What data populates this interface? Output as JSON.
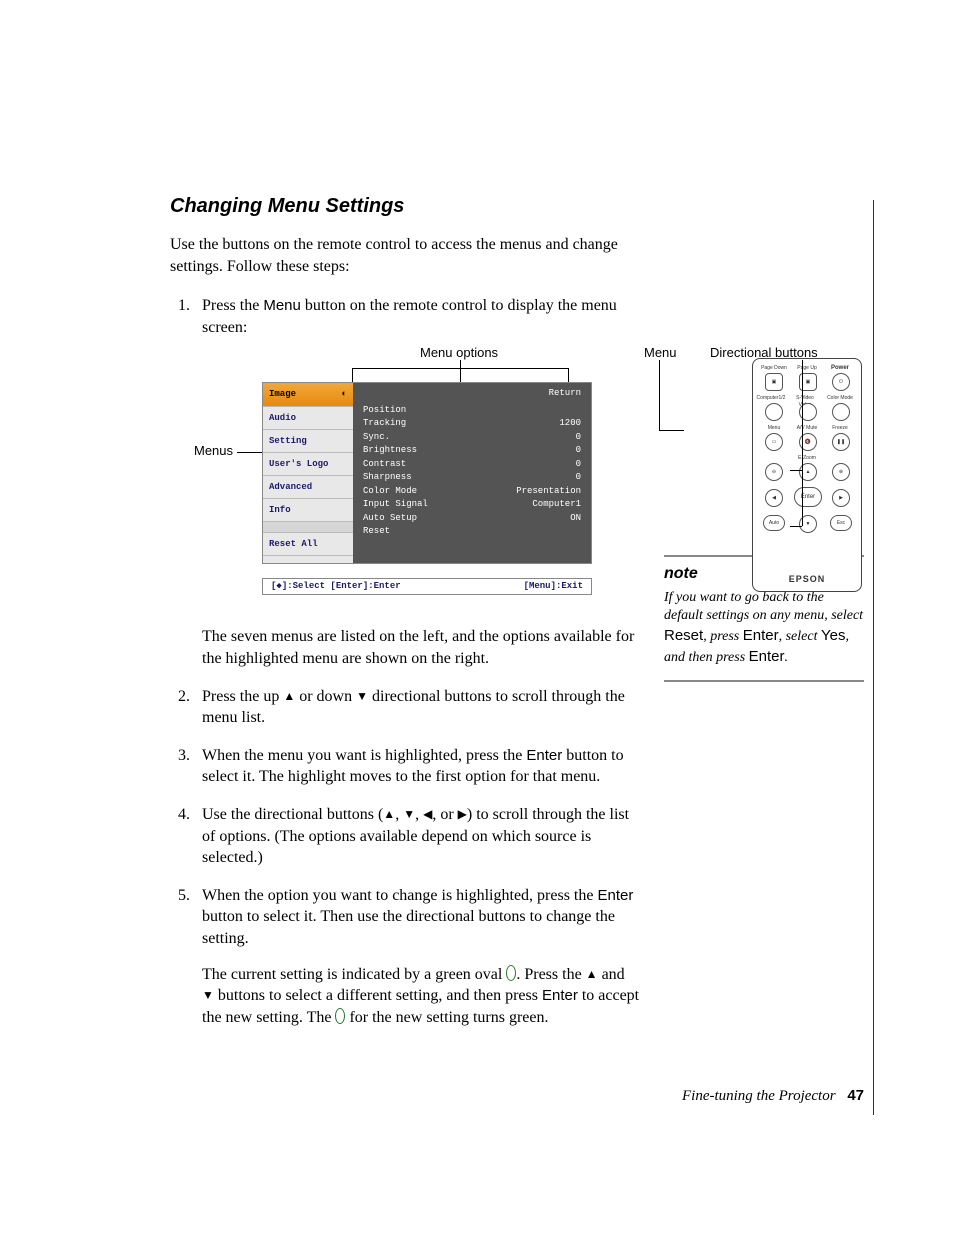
{
  "heading": "Changing Menu Settings",
  "intro": "Use the buttons on the remote control to access the menus and change settings. Follow these steps:",
  "steps": {
    "s1_a": "Press the ",
    "s1_menu": "Menu",
    "s1_b": " button on the remote control to display the menu screen:",
    "s1_after_a": "The seven menus are listed on the left, and the options available for the highlighted menu are shown on the right.",
    "s2_a": "Press the up ",
    "s2_b": " or down ",
    "s2_c": " directional buttons to scroll through the menu list.",
    "s3_a": "When the menu you want is highlighted, press the ",
    "s3_enter": "Enter",
    "s3_b": " button to select it. The highlight moves to the first option for that menu.",
    "s4_a": "Use the directional buttons (",
    "s4_b": ", ",
    "s4_c": ", ",
    "s4_d": ", or ",
    "s4_e": ") to scroll through the list of options. (The options available depend on which source is selected.)",
    "s5_a": "When the option you want to change is highlighted, press the ",
    "s5_enter": "Enter",
    "s5_b": " button to select it. Then use the directional buttons to change the setting.",
    "s5_p2_a": "The current setting is indicated by a green oval ",
    "s5_p2_b": ". Press the ",
    "s5_p2_c": " and ",
    "s5_p2_d": " buttons to select a different setting, and then press ",
    "s5_enter2": "Enter",
    "s5_p2_e": " to accept the new setting. The ",
    "s5_p2_f": " for the new setting turns green."
  },
  "figure": {
    "label_menu_options": "Menu options",
    "label_menus": "Menus",
    "label_menu": "Menu",
    "label_directional": "Directional buttons"
  },
  "osd": {
    "menus": [
      "Image",
      "Audio",
      "Setting",
      "User's Logo",
      "Advanced",
      "Info",
      "Reset All"
    ],
    "return": "Return",
    "options": [
      {
        "k": "Position",
        "v": ""
      },
      {
        "k": "Tracking",
        "v": "1200"
      },
      {
        "k": "Sync.",
        "v": "0"
      },
      {
        "k": "Brightness",
        "v": "0"
      },
      {
        "k": "Contrast",
        "v": "0"
      },
      {
        "k": "Sharpness",
        "v": "0"
      },
      {
        "k": "Color Mode",
        "v": "Presentation"
      },
      {
        "k": "Input Signal",
        "v": "Computer1"
      },
      {
        "k": "Auto Setup",
        "v": "ON"
      },
      {
        "k": "Reset",
        "v": ""
      }
    ],
    "footer_left": "[◆]:Select [Enter]:Enter",
    "footer_right": "[Menu]:Exit"
  },
  "remote": {
    "labels": {
      "page_down": "Page Down",
      "page_up": "Page Up",
      "power": "Power",
      "computer": "Computer1/2",
      "svideo": "S-Video Video",
      "colormode": "Color Mode",
      "menu": "Menu",
      "avmute": "A/V Mute",
      "freeze": "Freeze",
      "ezoom": "E-Zoom",
      "enter": "Enter",
      "auto": "Auto",
      "esc": "Esc"
    },
    "brand": "EPSON"
  },
  "note": {
    "title": "note",
    "a": "If you want to go back to the default settings on any menu, select ",
    "reset": "Reset",
    "b": ", press ",
    "enter": "Enter",
    "c": ", select ",
    "yes": "Yes",
    "d": ", and then press ",
    "enter2": "Enter",
    "e": "."
  },
  "footer": {
    "text": "Fine-tuning the Projector",
    "page": "47"
  }
}
